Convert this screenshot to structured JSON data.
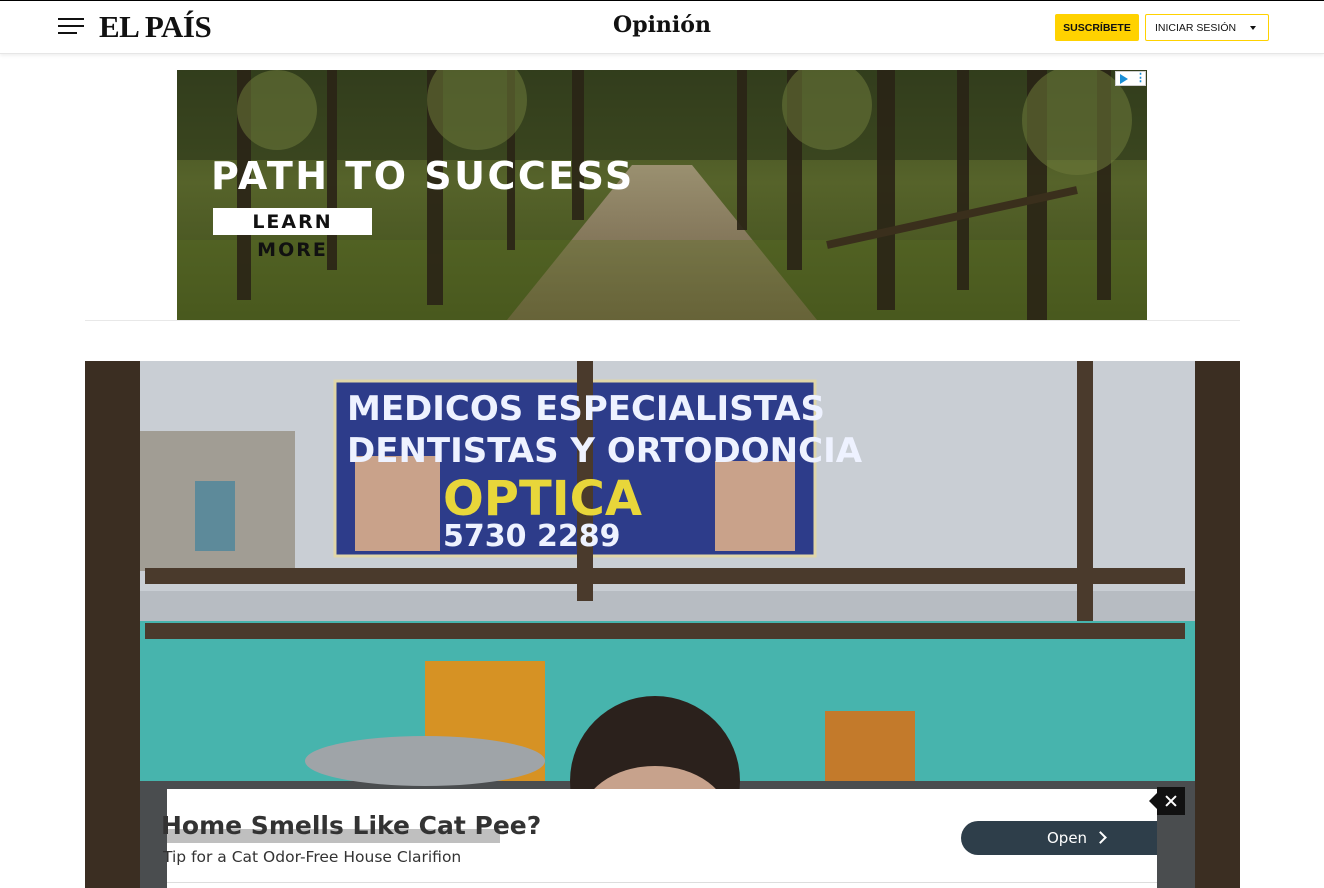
{
  "header": {
    "logo": "EL PAÍS",
    "section": "Opinión",
    "subscribe_label": "SUSCRÍBETE",
    "login_label": "INICIAR SESIÓN"
  },
  "top_ad": {
    "headline": "PATH TO SUCCESS",
    "cta": "LEARN MORE"
  },
  "photo": {
    "sign_line1": "MEDICOS ESPECIALISTAS",
    "sign_line2": "DENTISTAS Y ORTODONCIA",
    "sign_line3": "OPTICA",
    "sign_phone": "5730 2289"
  },
  "bottom_ad": {
    "title": "Home Smells Like Cat Pee?",
    "subtitle": "Tip for a Cat Odor-Free House Clarifion",
    "open_label": "Open"
  },
  "colors": {
    "subscribe_yellow": "#ffd200",
    "open_button": "#2e3e4a",
    "adchoices_blue": "#1a8fd6"
  }
}
